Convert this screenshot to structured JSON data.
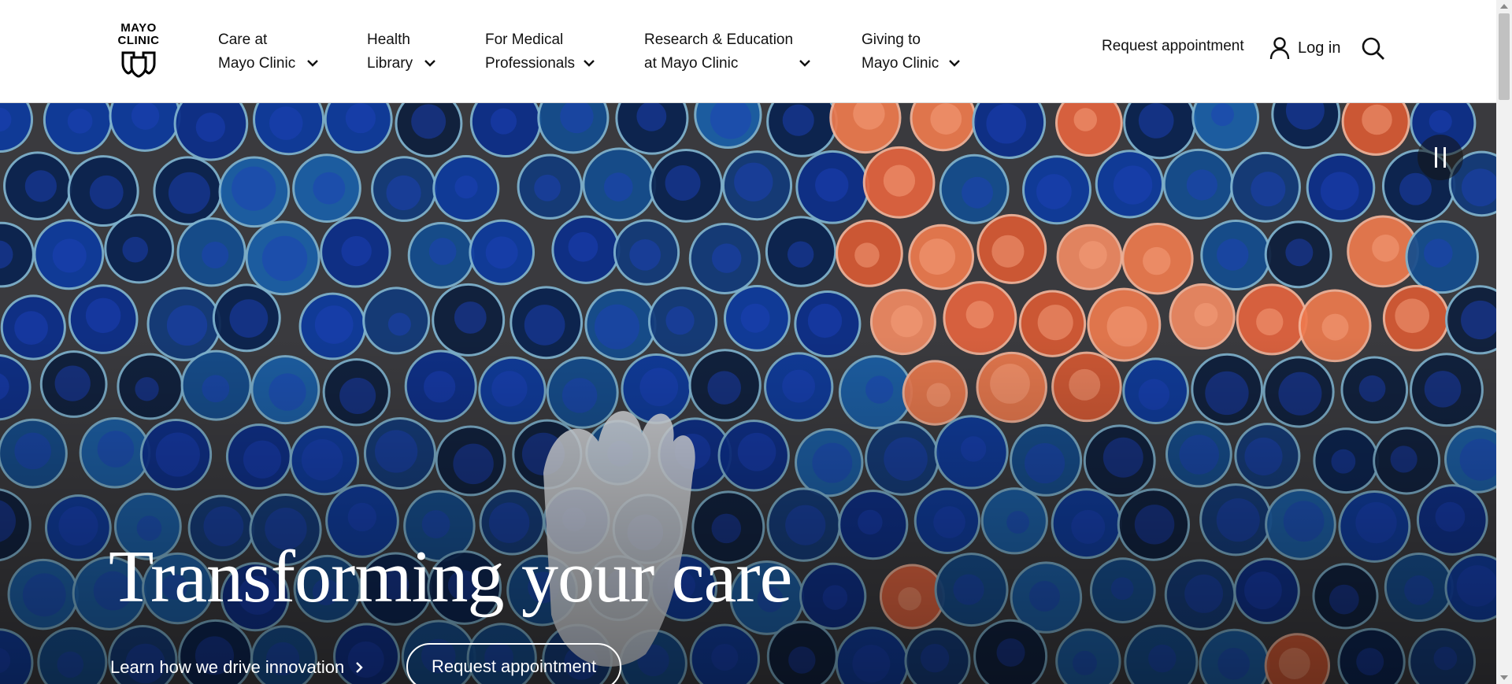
{
  "logo": {
    "line1": "MAYO",
    "line2": "CLINIC"
  },
  "nav": [
    {
      "line1": "Care at",
      "line2": "Mayo Clinic"
    },
    {
      "line1": "Health",
      "line2": "Library"
    },
    {
      "line1": "For Medical",
      "line2": "Professionals"
    },
    {
      "line1": "Research & Education",
      "line2": "at Mayo Clinic"
    },
    {
      "line1": "Giving to",
      "line2": "Mayo Clinic"
    }
  ],
  "header_actions": {
    "request_appointment": "Request appointment",
    "login": "Log in",
    "user_icon": "user-icon",
    "search_icon": "search-icon"
  },
  "hero": {
    "title": "Transforming your care",
    "learn_link": "Learn how we drive innovation",
    "cta": "Request appointment",
    "pause_icon": "pause-icon",
    "colors": {
      "dish_blue": "#0d3a9e",
      "dish_orange": "#e4643e",
      "table": "#3a3a3e"
    }
  }
}
